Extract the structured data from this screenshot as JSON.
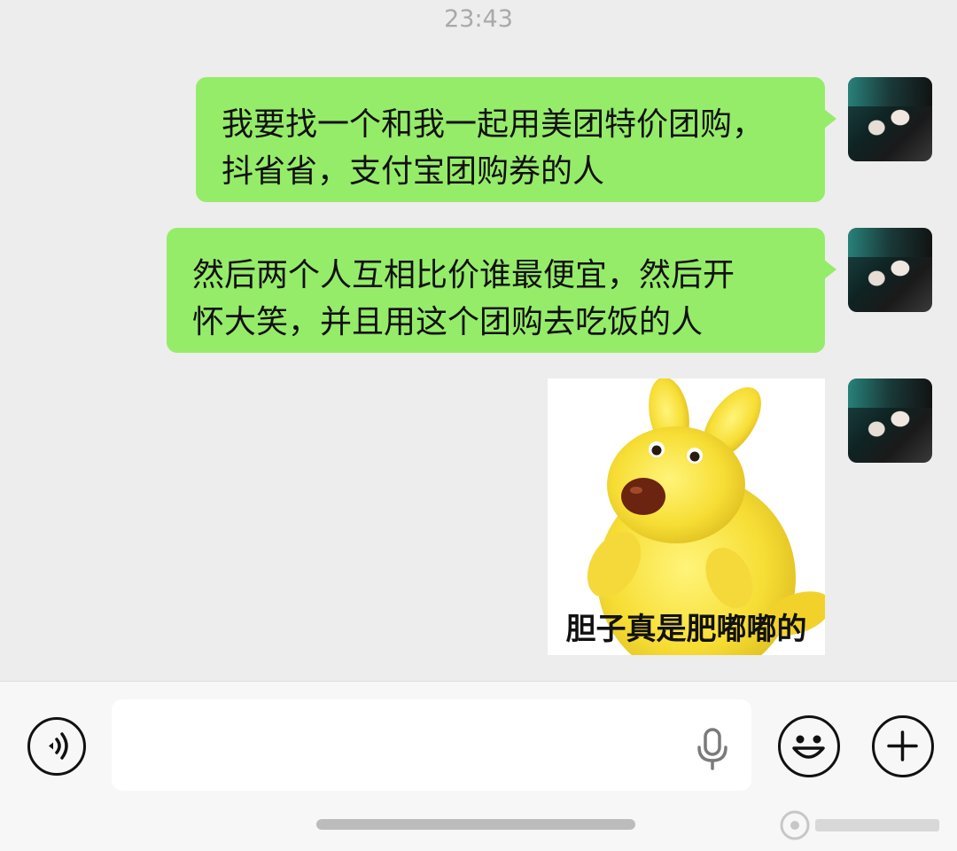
{
  "chat": {
    "timestamp": "23:43",
    "messages": [
      {
        "type": "text",
        "sender": "self",
        "lines": [
          "我要找一个和我一起用美团特价团购，",
          "抖省省，支付宝团购券的人"
        ]
      },
      {
        "type": "text",
        "sender": "self",
        "lines": [
          "然后两个人互相比价谁最便宜，然后开",
          "怀大笑，并且用这个团购去吃饭的人"
        ]
      },
      {
        "type": "sticker",
        "sender": "self",
        "caption": "胆子真是肥嘟嘟的",
        "icon": "yellow-kangaroo-sticker"
      }
    ]
  },
  "input_bar": {
    "voice_icon": "voice-mode-icon",
    "mic_icon": "microphone-icon",
    "emoji_icon": "emoji-smile-icon",
    "plus_icon": "plus-icon",
    "text_value": ""
  },
  "colors": {
    "background": "#ededed",
    "bubble_self": "#95ec69",
    "timestamp": "#a9a9a9"
  }
}
